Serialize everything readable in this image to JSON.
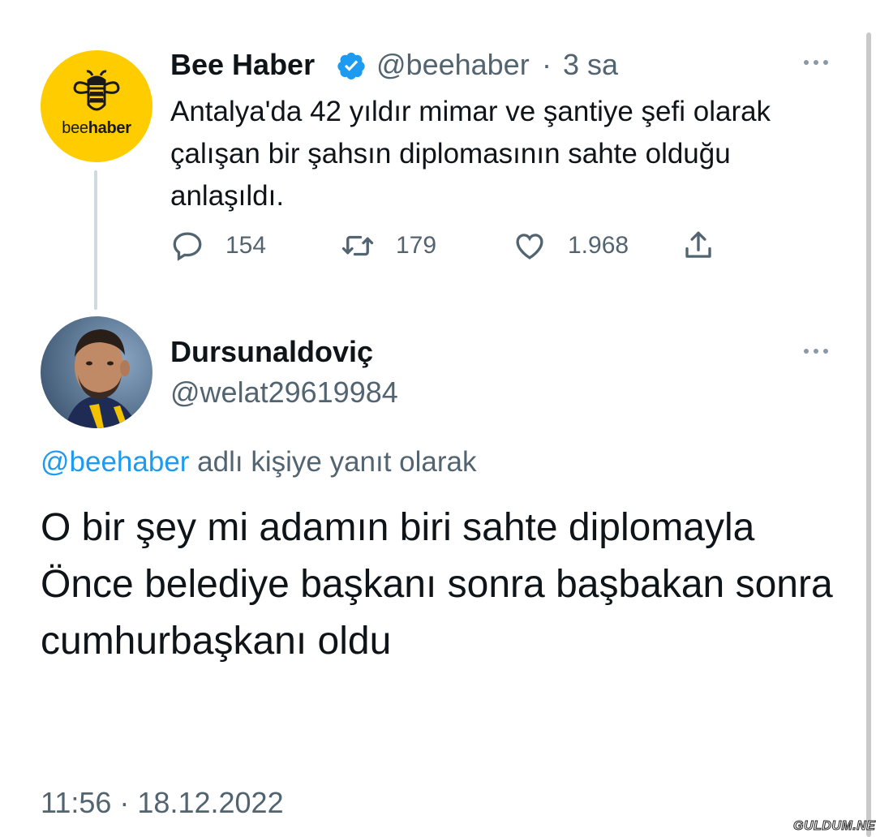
{
  "colors": {
    "accent": "#1d9bf0",
    "secondary_text": "#536471",
    "primary_text": "#0f1419",
    "avatar_brand": "#ffcc00"
  },
  "original_tweet": {
    "avatar_brand_prefix": "bee",
    "avatar_brand_suffix": "haber",
    "display_name": "Bee Haber",
    "verified_icon": "verified-badge-icon",
    "handle": "@beehaber",
    "separator": "·",
    "time_ago": "3 sa",
    "text": "Antalya'da 42 yıldır mimar ve şantiye şefi olarak çalışan bir şahsın diplomasının sahte olduğu anlaşıldı.",
    "actions": {
      "reply_count": "154",
      "retweet_count": "179",
      "like_count": "1.968"
    }
  },
  "reply_tweet": {
    "display_name": "Dursunaldoviç",
    "handle": "@welat29619984",
    "replying_to_mention": "@beehaber",
    "replying_to_suffix": " adlı kişiye yanıt olarak",
    "text": "O bir şey mi adamın biri sahte diplomayla  Önce belediye başkanı sonra başbakan sonra cumhurbaşkanı oldu",
    "timestamp": "11:56 · 18.12.2022"
  },
  "watermark": "GULDUM.NET"
}
